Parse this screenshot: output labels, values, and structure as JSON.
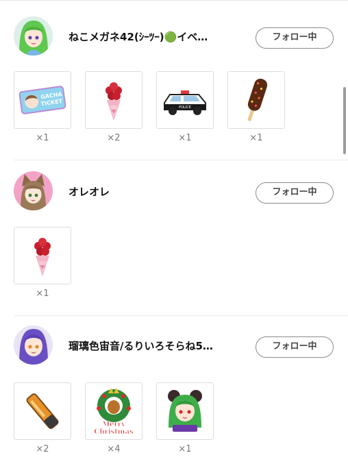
{
  "entries": [
    {
      "username": "ねこメガネ42(ｼｰﾂｰ)🟢イベ…",
      "follow_label": "フォロー中",
      "avatar_icon": "avatar-green-hair-girl",
      "gifts": [
        {
          "icon": "gacha-ticket-icon",
          "count": "×1"
        },
        {
          "icon": "rose-bouquet-icon",
          "count": "×2"
        },
        {
          "icon": "police-car-icon",
          "count": "×1"
        },
        {
          "icon": "choco-banana-icon",
          "count": "×1"
        }
      ]
    },
    {
      "username": "オレオレ",
      "follow_label": "フォロー中",
      "avatar_icon": "avatar-fox-ears-girl",
      "gifts": [
        {
          "icon": "rose-bouquet-icon",
          "count": "×1"
        }
      ]
    },
    {
      "username": "瑠璃色宙音/るりいろそらね5…",
      "follow_label": "フォロー中",
      "avatar_icon": "avatar-purple-hair-girl",
      "gifts": [
        {
          "icon": "glowstick-icon",
          "count": "×2"
        },
        {
          "icon": "merry-christmas-wreath-icon",
          "count": "×4"
        },
        {
          "icon": "green-hair-girl-sticker-icon",
          "count": "×1"
        }
      ]
    }
  ],
  "gift_text": {
    "ticket_line1": "GACHA",
    "ticket_line2": "TICKET",
    "police_text": "POLICE",
    "xmas_line1": "Merry",
    "xmas_line2": "Christmas"
  },
  "colors": {
    "follow_border": "#8a8a8a",
    "tile_border": "#dcdcdc",
    "count_text": "#777777"
  }
}
